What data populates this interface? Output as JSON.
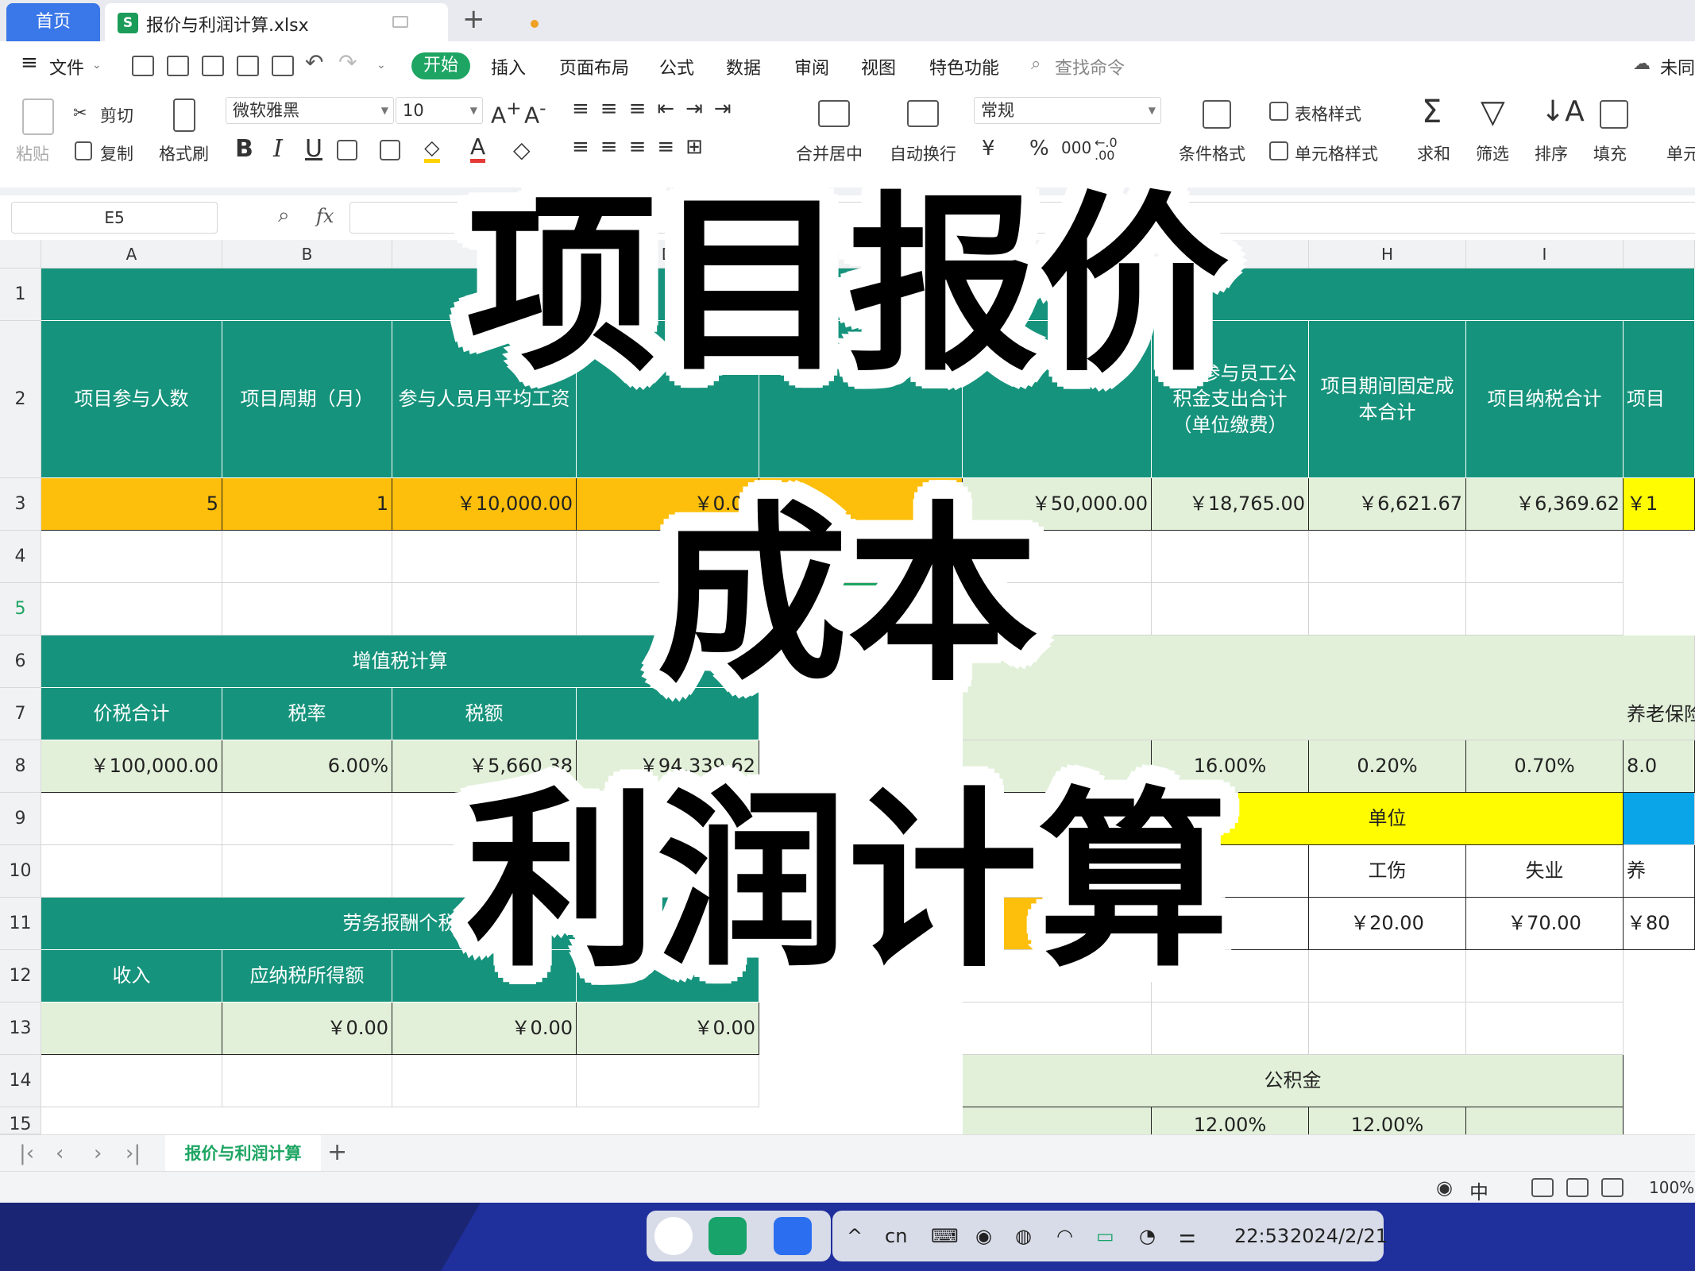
{
  "tabs": {
    "home": "首页",
    "file": "报价与利润计算.xlsx"
  },
  "menu": {
    "file": "文件",
    "items": [
      "开始",
      "插入",
      "页面布局",
      "公式",
      "数据",
      "审阅",
      "视图",
      "特色功能"
    ],
    "search": "查找命令",
    "sync": "未同"
  },
  "ribbon": {
    "paste": "粘贴",
    "cut": "剪切",
    "copy": "复制",
    "format_painter": "格式刷",
    "font": "微软雅黑",
    "size": "10",
    "bold": "B",
    "italic": "I",
    "underline": "U",
    "merge": "合并居中",
    "wrap": "自动换行",
    "number_format": "常规",
    "currency": "¥",
    "percent": "%",
    "thousands": "000",
    "cond_format": "条件格式",
    "table_style": "表格样式",
    "cell_style": "单元格样式",
    "sum": "求和",
    "filter": "筛选",
    "sort": "排序",
    "fill": "填充",
    "cell": "单元"
  },
  "formula_bar": {
    "name_box": "E5",
    "fx": "fx"
  },
  "columns": [
    "A",
    "B",
    "C",
    "D",
    "E",
    "F",
    "G",
    "H",
    "I"
  ],
  "rows": [
    "1",
    "2",
    "3",
    "4",
    "5",
    "6",
    "7",
    "8",
    "9",
    "10",
    "11",
    "12",
    "13",
    "14",
    "15"
  ],
  "cells": {
    "A2": "项目参与人数",
    "B2": "项目周期（月）",
    "C2": "参与人员月平均工资",
    "G2": "项目参与员工公积金支出合计（单位缴费）",
    "H2": "项目期间固定成本合计",
    "I2": "项目纳税合计",
    "J2": "项目",
    "A3": "5",
    "B3": "1",
    "C3": "￥10,000.00",
    "D3": "￥0.00",
    "E3": "￥0",
    "F3": "￥50,000.00",
    "G3": "￥18,765.00",
    "H3": "￥6,621.67",
    "I3": "￥6,369.62",
    "J3": "￥1",
    "A6": "增值税计算",
    "A7": "价税合计",
    "B7": "税率",
    "C7": "税额",
    "A8": "￥100,000.00",
    "B8": "6.00%",
    "C8": "￥5,660.38",
    "D8": "￥94,339.62",
    "J7": "养老保险",
    "G8": "16.00%",
    "H8": "0.20%",
    "I8": "0.70%",
    "J8": "8.0",
    "H9": "单位",
    "H10": "工伤",
    "I10": "失业",
    "J10": "养",
    "F11": "0,000",
    "H11": "￥20.00",
    "I11": "￥70.00",
    "J11": "￥80",
    "A11": "劳务报酬个税",
    "A12": "收入",
    "B12": "应纳税所得额",
    "B13": "￥0.00",
    "C13": "￥0.00",
    "D13": "￥0.00",
    "F14": "公积金",
    "G15": "12.00%",
    "H15": "12.00%"
  },
  "sheet_tab": "报价与利润计算",
  "status": {
    "zoom": "100%"
  },
  "taskbar": {
    "lang": "cn",
    "time": "22:53",
    "date": "2024/2/21"
  },
  "overlay": {
    "line1": "项目报价",
    "line2": "成本",
    "line3": "利润计算"
  },
  "colors": {
    "teal": "#16937c",
    "orange": "#fdbf0b",
    "light_green": "#e2f0d9",
    "yellow": "#fffb00",
    "blue": "#0aa4e8",
    "accent": "#1ea563"
  }
}
